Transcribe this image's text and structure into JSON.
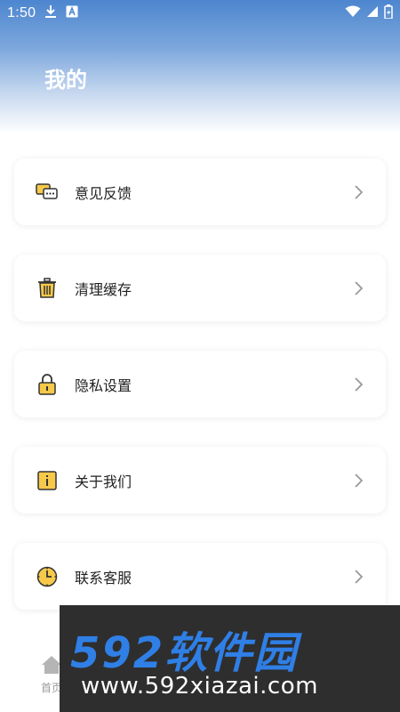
{
  "status_bar": {
    "time": "1:50",
    "icons": [
      "download-icon",
      "a-icon",
      "wifi-icon",
      "signal-icon",
      "battery-icon"
    ]
  },
  "header": {
    "title": "我的",
    "gradient_top": "#4d86cf"
  },
  "menu": {
    "items": [
      {
        "label": "意见反馈",
        "icon": "feedback-icon"
      },
      {
        "label": "清理缓存",
        "icon": "trash-icon"
      },
      {
        "label": "隐私设置",
        "icon": "lock-icon"
      },
      {
        "label": "关于我们",
        "icon": "info-icon"
      },
      {
        "label": "联系客服",
        "icon": "clock-icon"
      }
    ],
    "accent": "#f6c94a"
  },
  "bottom_nav": {
    "home_label": "首页",
    "home_icon": "home-icon"
  },
  "watermark": {
    "brand": "592软件园",
    "url": "www.592xiazai.com"
  }
}
